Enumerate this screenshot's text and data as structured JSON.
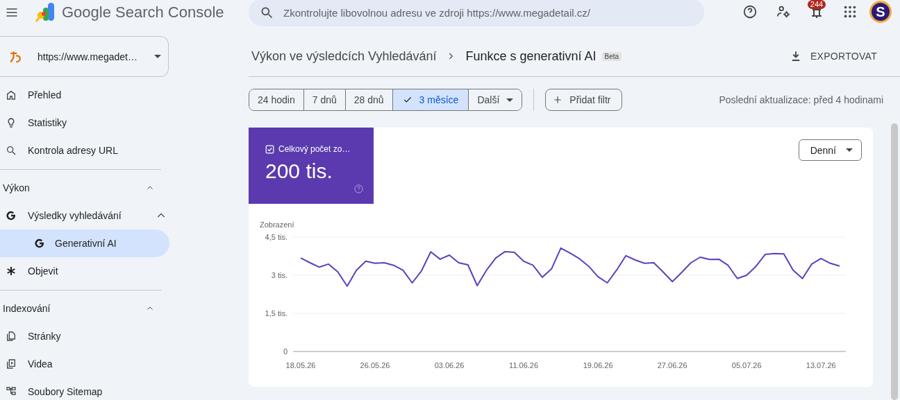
{
  "header": {
    "title": "Google Search Console",
    "search": {
      "placeholder": "Zkontrolujte libovolnou adresu ve zdroji https://www.megadetail.cz/"
    },
    "notifications": "244",
    "avatar": "S"
  },
  "property": {
    "label": "https://www.megadet…"
  },
  "sidebar": {
    "groups": [
      {
        "items": [
          {
            "label": "Přehled",
            "selected": false
          },
          {
            "label": "Statistiky",
            "selected": false
          },
          {
            "label": "Kontrola adresy URL",
            "selected": false
          }
        ]
      },
      {
        "title": "Výkon",
        "expanded": true,
        "items": [
          {
            "label": "Výsledky vyhledávání",
            "selected": false,
            "expanded": true,
            "children": [
              {
                "label": "Generativní AI",
                "selected": true
              }
            ]
          },
          {
            "label": "Objevit",
            "selected": false
          }
        ]
      },
      {
        "title": "Indexování",
        "expanded": true,
        "items": [
          {
            "label": "Stránky",
            "selected": false
          },
          {
            "label": "Videa",
            "selected": false
          },
          {
            "label": "Soubory Sitemap",
            "selected": false
          }
        ]
      }
    ]
  },
  "breadcrumb": {
    "parent": "Výkon ve výsledcích Vyhledávání",
    "current": "Funkce s generativní AI",
    "badge": "Beta"
  },
  "export": "EXPORTOVAT",
  "date_ranges": [
    {
      "label": "24 hodin",
      "selected": false
    },
    {
      "label": "7 dnů",
      "selected": false
    },
    {
      "label": "28 dnů",
      "selected": false
    },
    {
      "label": "3 měsíce",
      "selected": true
    }
  ],
  "more": "Další",
  "add_filter": "Přidat filtr",
  "last_update": "Poslední aktualizace: před 4 hodinami",
  "metric": {
    "label": "Celkový počet zo…",
    "value": "200 tis.",
    "checked": true
  },
  "granularity": "Denní",
  "chart_data": {
    "type": "line",
    "ylabel": "Zobrazení",
    "categories": [
      "18.05.26",
      null,
      null,
      null,
      null,
      null,
      null,
      null,
      "26.05.26",
      null,
      null,
      null,
      null,
      null,
      null,
      null,
      "03.06.26",
      null,
      null,
      null,
      null,
      null,
      null,
      null,
      "11.06.26",
      null,
      null,
      null,
      null,
      null,
      null,
      null,
      "19.06.26",
      null,
      null,
      null,
      null,
      null,
      null,
      null,
      "27.06.26",
      null,
      null,
      null,
      null,
      null,
      null,
      null,
      "05.07.26",
      null,
      null,
      null,
      null,
      null,
      null,
      null,
      "13.07.26",
      null,
      null
    ],
    "series": [
      {
        "color": "#5e3fbe",
        "values": [
          3.68,
          3.49,
          3.32,
          3.44,
          3.13,
          2.57,
          3.2,
          3.55,
          3.47,
          3.49,
          3.39,
          3.2,
          2.7,
          3.17,
          3.92,
          3.63,
          3.79,
          3.49,
          3.41,
          2.59,
          3.2,
          3.68,
          3.93,
          3.9,
          3.55,
          3.39,
          2.92,
          3.25,
          4.07,
          3.87,
          3.65,
          3.35,
          2.94,
          2.7,
          3.2,
          3.77,
          3.6,
          3.47,
          3.49,
          3.13,
          2.75,
          3.11,
          3.49,
          3.71,
          3.62,
          3.63,
          3.39,
          2.87,
          3.0,
          3.35,
          3.82,
          3.85,
          3.84,
          3.2,
          2.87,
          3.44,
          3.66,
          3.47,
          3.36
        ]
      }
    ],
    "ylim": [
      0,
      4.5
    ],
    "yticks": [
      {
        "value": 0,
        "label": "0"
      },
      {
        "value": 1.5,
        "label": "1,5 tis."
      },
      {
        "value": 3,
        "label": "3 tis."
      },
      {
        "value": 4.5,
        "label": "4,5 tis."
      }
    ]
  }
}
